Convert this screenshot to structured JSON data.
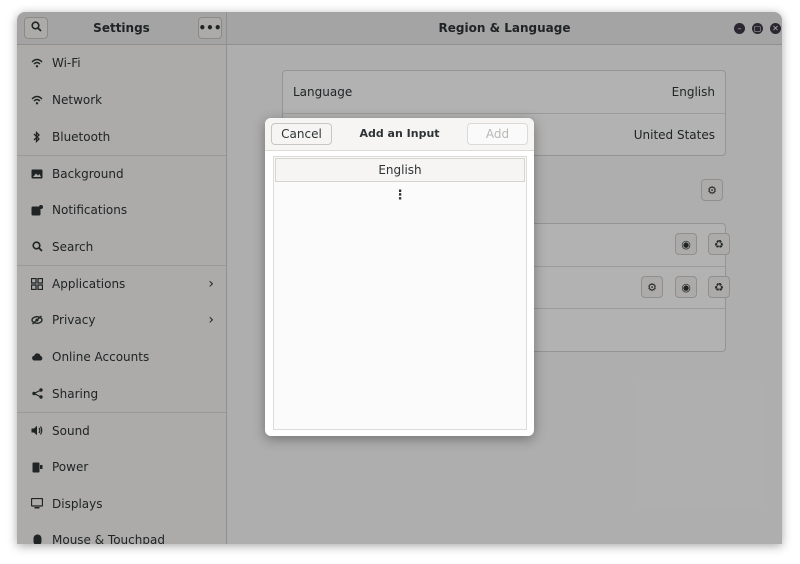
{
  "sidebar": {
    "title": "Settings",
    "search_icon": "search-icon",
    "menu_icon": "more-horizontal-icon",
    "items": [
      {
        "label": "Wi-Fi",
        "icon": "wifi-icon"
      },
      {
        "label": "Network",
        "icon": "network-icon"
      },
      {
        "label": "Bluetooth",
        "icon": "bluetooth-icon"
      },
      {
        "label": "Background",
        "icon": "background-icon"
      },
      {
        "label": "Notifications",
        "icon": "notifications-icon"
      },
      {
        "label": "Search",
        "icon": "search-icon"
      },
      {
        "label": "Applications",
        "icon": "applications-icon"
      },
      {
        "label": "Privacy",
        "icon": "privacy-icon"
      },
      {
        "label": "Online Accounts",
        "icon": "cloud-icon"
      },
      {
        "label": "Sharing",
        "icon": "share-icon"
      },
      {
        "label": "Sound",
        "icon": "sound-icon"
      },
      {
        "label": "Power",
        "icon": "power-icon"
      },
      {
        "label": "Displays",
        "icon": "display-icon"
      },
      {
        "label": "Mouse & Touchpad",
        "icon": "mouse-icon"
      }
    ]
  },
  "main": {
    "title": "Region & Language",
    "language_label": "Language",
    "language_value": "English",
    "formats_value": "United States"
  },
  "dialog": {
    "cancel_label": "Cancel",
    "title": "Add an Input Source",
    "add_label": "Add",
    "list": {
      "item_0": "English",
      "more": "⋮"
    }
  },
  "colors": {
    "overlay": "#000000",
    "accent": "#2e3436"
  }
}
